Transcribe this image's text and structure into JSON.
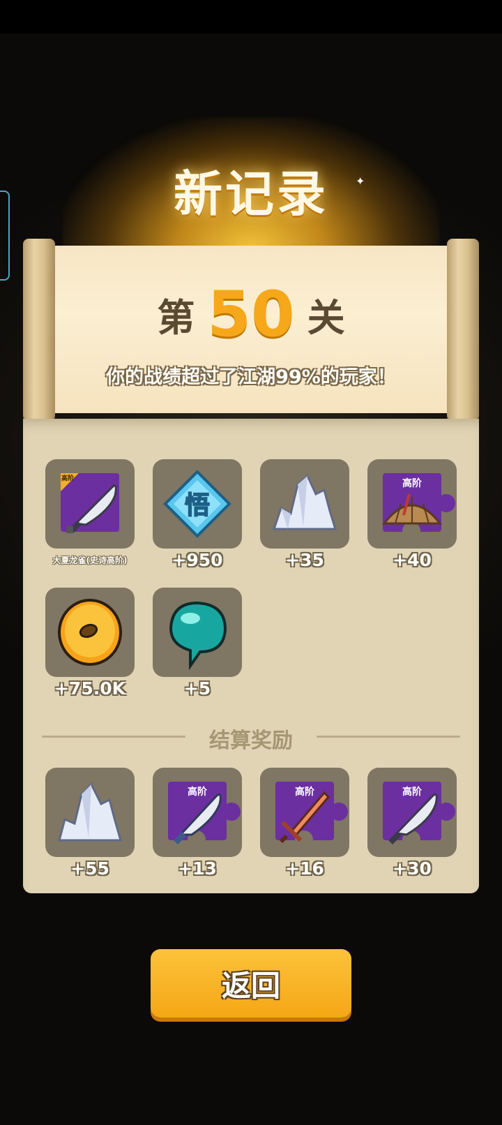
{
  "header": {
    "title": "新记录"
  },
  "level": {
    "prefix": "第",
    "number": "50",
    "suffix": "关"
  },
  "subtitle": "你的战绩超过了江湖99%的玩家！",
  "colors": {
    "accent": "#f6a81a",
    "panel": "#e0d4b4",
    "tile": "#807664",
    "epic_purple": "#6b2fa0",
    "button": "#f9b526"
  },
  "rewards": [
    {
      "icon": "scimitar-icon",
      "corner_tag": "高阶",
      "caption": "大夏龙雀(史诗高阶)"
    },
    {
      "icon": "wu-insight-gem-icon",
      "glyph": "悟",
      "caption": "+950"
    },
    {
      "icon": "crystal-shard-icon",
      "caption": "+35"
    },
    {
      "icon": "straw-hat-fragment-icon",
      "tag": "高阶",
      "caption": "+40"
    },
    {
      "icon": "gold-coin-icon",
      "caption": "+75.0K"
    },
    {
      "icon": "teal-soul-orb-icon",
      "caption": "+5"
    }
  ],
  "settlement": {
    "title": "结算奖励",
    "items": [
      {
        "icon": "crystal-shard-icon",
        "caption": "+55"
      },
      {
        "icon": "blade-fragment-icon",
        "tag": "高阶",
        "caption": "+13"
      },
      {
        "icon": "sword-fragment-icon",
        "tag": "高阶",
        "caption": "+16"
      },
      {
        "icon": "scimitar-fragment-icon",
        "tag": "高阶",
        "caption": "+30"
      }
    ]
  },
  "back_button": {
    "label": "返回"
  }
}
